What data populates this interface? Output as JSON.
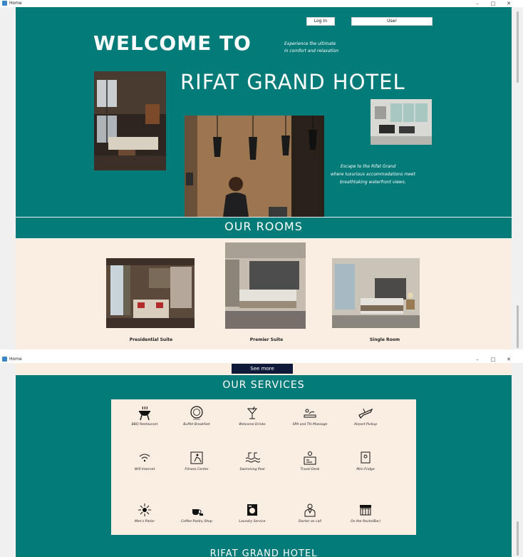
{
  "window": {
    "title": "Home",
    "min": "–",
    "max": "□",
    "close": "✕"
  },
  "header": {
    "login_label": "Log In",
    "user_label": "User",
    "welcome_line1": "WELCOME TO",
    "tagline_line1": "Experience the ultimate",
    "tagline_line2": "in comfort and relaxation",
    "hotel_name": "RIFAT GRAND HOTEL",
    "escape_line1": "Escape to the Rifat Grand",
    "escape_line2": "where luxurious accommodations meet",
    "escape_line3": "breathtaking waterfront views."
  },
  "rooms": {
    "heading": "OUR ROOMS",
    "items": [
      {
        "label": "Presidential Suite"
      },
      {
        "label": "Premier Suite"
      },
      {
        "label": "Single Room"
      }
    ]
  },
  "see_more_label": "See more",
  "services": {
    "heading": "OUR SERVICES",
    "items": [
      {
        "label": "BBQ Restaurant",
        "icon": "bbq-grill-icon"
      },
      {
        "label": "Buffet Breakfast",
        "icon": "buffet-plate-icon"
      },
      {
        "label": "Welcome Drinks",
        "icon": "cocktail-icon"
      },
      {
        "label": "SPA and Thi Massage",
        "icon": "spa-massage-icon"
      },
      {
        "label": "Airport Pickup",
        "icon": "airplane-icon"
      },
      {
        "label": "Wifi Internet",
        "icon": "wifi-icon"
      },
      {
        "label": "Fitness Center",
        "icon": "fitness-icon"
      },
      {
        "label": "Swimming Pool",
        "icon": "swimming-pool-icon"
      },
      {
        "label": "Travel Desk",
        "icon": "travel-desk-icon"
      },
      {
        "label": "Mini Fridge",
        "icon": "mini-fridge-icon"
      },
      {
        "label": "Men's Parlor",
        "icon": "parlor-icon"
      },
      {
        "label": "Coffee Pastry Shop",
        "icon": "coffee-shop-icon"
      },
      {
        "label": "Laundry Service",
        "icon": "laundry-icon"
      },
      {
        "label": "Doctor on call",
        "icon": "doctor-icon"
      },
      {
        "label": "On the Rocks(Bar)",
        "icon": "bar-icon"
      }
    ]
  },
  "footer_heading": "RIFAT GRAND HOTEL",
  "colors": {
    "teal": "#037b78",
    "cream": "#faede2",
    "navy": "#0f1a3a",
    "white": "#ffffff"
  }
}
